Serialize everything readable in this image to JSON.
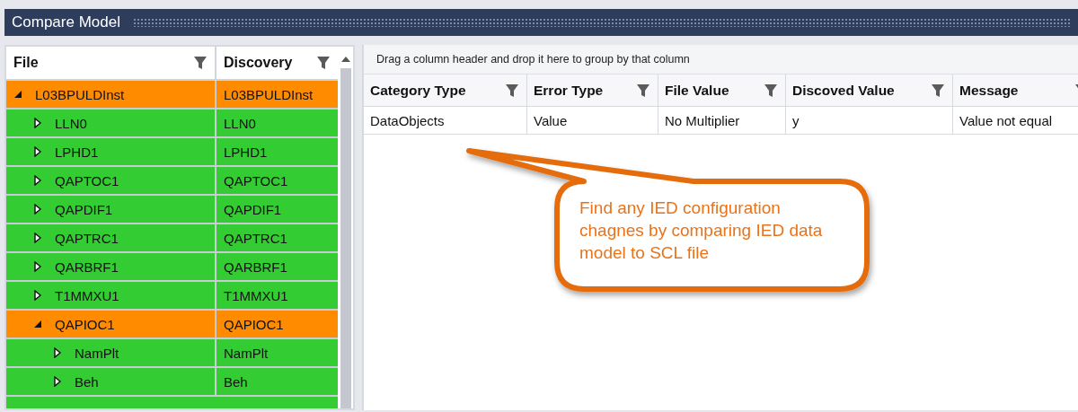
{
  "window": {
    "title": "Compare Model"
  },
  "tree": {
    "columns": [
      "File",
      "Discovery"
    ],
    "rows": [
      {
        "file": "L03BPULDInst",
        "discovery": "L03BPULDInst",
        "color": "#ff8c00",
        "expanded": true,
        "children": [
          {
            "file": "LLN0",
            "discovery": "LLN0",
            "color": "#33cc33",
            "expanded": false
          },
          {
            "file": "LPHD1",
            "discovery": "LPHD1",
            "color": "#33cc33",
            "expanded": false
          },
          {
            "file": "QAPTOC1",
            "discovery": "QAPTOC1",
            "color": "#33cc33",
            "expanded": false
          },
          {
            "file": "QAPDIF1",
            "discovery": "QAPDIF1",
            "color": "#33cc33",
            "expanded": false
          },
          {
            "file": "QAPTRC1",
            "discovery": "QAPTRC1",
            "color": "#33cc33",
            "expanded": false
          },
          {
            "file": "QARBRF1",
            "discovery": "QARBRF1",
            "color": "#33cc33",
            "expanded": false
          },
          {
            "file": "T1MMXU1",
            "discovery": "T1MMXU1",
            "color": "#33cc33",
            "expanded": false
          },
          {
            "file": "QAPIOC1",
            "discovery": "QAPIOC1",
            "color": "#ff8c00",
            "expanded": true,
            "children": [
              {
                "file": "NamPlt",
                "discovery": "NamPlt",
                "color": "#33cc33",
                "expanded": false
              },
              {
                "file": "Beh",
                "discovery": "Beh",
                "color": "#33cc33",
                "expanded": false
              }
            ]
          }
        ]
      }
    ]
  },
  "grid": {
    "group_hint": "Drag a column header and drop it here to group by that column",
    "columns": [
      "Category Type",
      "Error Type",
      "File Value",
      "Discoved Value",
      "Message"
    ],
    "rows": [
      [
        "DataObjects",
        "Value",
        "No Multiplier",
        "y",
        "Value not equal"
      ]
    ]
  },
  "callout": {
    "text": "Find any IED configuration chagnes by comparing IED data model to SCL file"
  }
}
